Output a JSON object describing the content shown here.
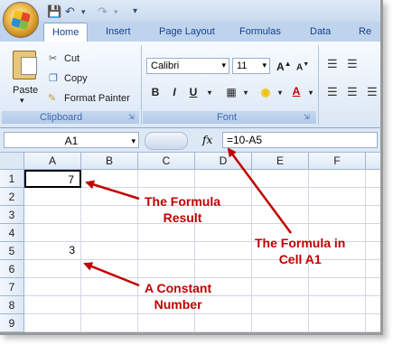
{
  "ribbon_tabs": {
    "home": "Home",
    "insert": "Insert",
    "page_layout": "Page Layout",
    "formulas": "Formulas",
    "data": "Data",
    "review": "Re"
  },
  "clipboard": {
    "paste": "Paste",
    "cut": "Cut",
    "copy": "Copy",
    "format_painter": "Format Painter",
    "group_label": "Clipboard"
  },
  "font_group": {
    "font_name": "Calibri",
    "font_size": "11",
    "group_label": "Font",
    "bold": "B",
    "italic": "I",
    "underline": "U"
  },
  "formula_bar": {
    "name_box": "A1",
    "fx": "fx",
    "formula": "=10-A5"
  },
  "sheet": {
    "columns": [
      "A",
      "B",
      "C",
      "D",
      "E",
      "F"
    ],
    "rows": [
      "1",
      "2",
      "3",
      "4",
      "5",
      "6",
      "7",
      "8",
      "9"
    ],
    "a1": "7",
    "a5": "3"
  },
  "annotations": {
    "formula_result": "The Formula\nResult",
    "formula_in_cell": "The Formula in\nCell A1",
    "constant_number": "A Constant\nNumber"
  },
  "colors": {
    "annotation": "#c00000",
    "ribbon_text": "#15428b"
  }
}
